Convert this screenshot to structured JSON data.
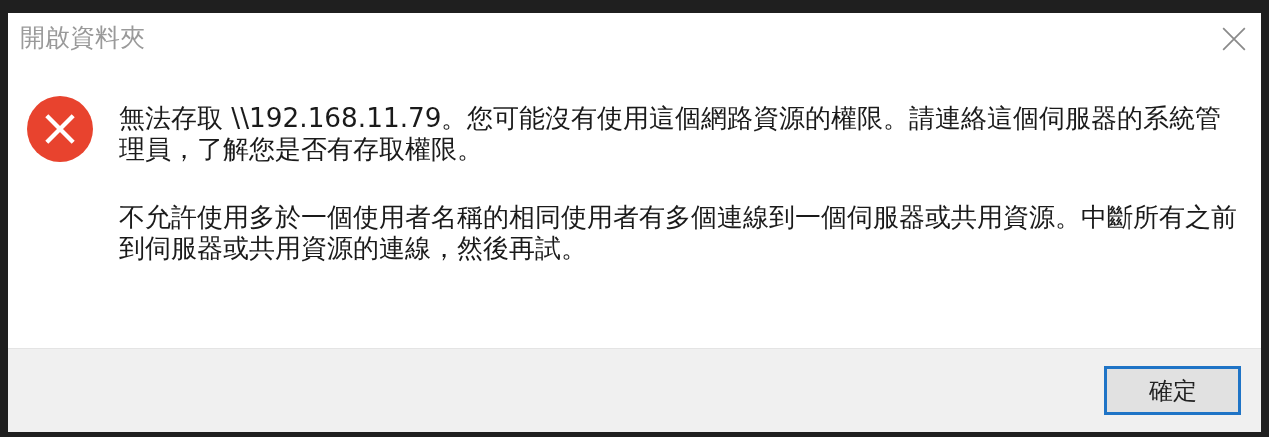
{
  "window": {
    "title": "開啟資料夾"
  },
  "messages": [
    "無法存取 \\\\192.168.11.79。您可能沒有使用這個網路資源的權限。請連絡這個伺服器的系統管理員，了解您是否有存取權限。",
    "不允許使用多於一個使用者名稱的相同使用者有多個連線到一個伺服器或共用資源。中斷所有之前到伺服器或共用資源的連線，然後再試。"
  ],
  "buttons": [
    {
      "label": "確定",
      "selected": true
    }
  ]
}
